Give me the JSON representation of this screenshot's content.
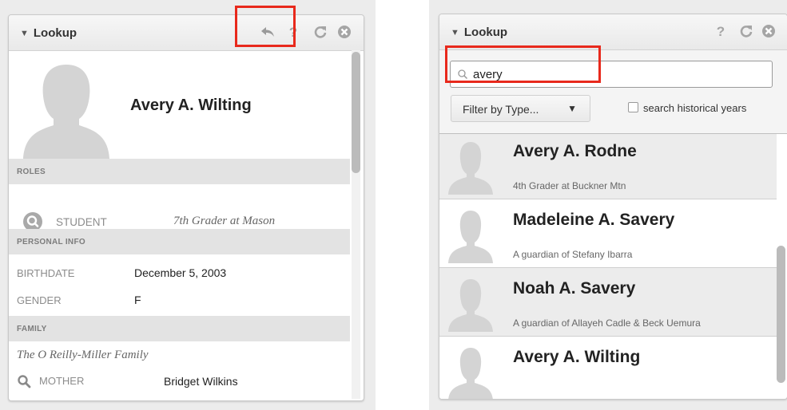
{
  "left_panel": {
    "header": {
      "title": "Lookup"
    },
    "person": {
      "name": "Avery A. Wilting"
    },
    "roles": {
      "heading": "ROLES",
      "items": [
        {
          "role": "STUDENT",
          "detail": "7th Grader at Mason"
        }
      ]
    },
    "personal_info": {
      "heading": "PERSONAL INFO",
      "fields": [
        {
          "label": "BIRTHDATE",
          "value": "December 5, 2003"
        },
        {
          "label": "GENDER",
          "value": "F"
        }
      ]
    },
    "family": {
      "heading": "FAMILY",
      "family_name": "The O Reilly-Miller Family",
      "members": [
        {
          "relation": "MOTHER",
          "name": "Bridget Wilkins"
        }
      ]
    }
  },
  "right_panel": {
    "header": {
      "title": "Lookup"
    },
    "search": {
      "value": "avery"
    },
    "filter": {
      "label": "Filter by Type..."
    },
    "historical_checkbox": {
      "label": "search historical years",
      "checked": false
    },
    "results": [
      {
        "name": "Avery A. Rodne",
        "subtitle": "4th Grader at Buckner Mtn"
      },
      {
        "name": "Madeleine A. Savery",
        "subtitle": "A guardian of Stefany Ibarra"
      },
      {
        "name": "Noah A. Savery",
        "subtitle": "A guardian of Allayeh Cadle & Beck Uemura"
      },
      {
        "name": "Avery A. Wilting",
        "subtitle": ""
      }
    ]
  },
  "colors": {
    "highlight_box": "#e8291c",
    "section_bg": "#e3e3e3",
    "avatar": "#d4d4d4"
  },
  "icons": [
    "collapse-triangle-icon",
    "back-arrow-icon",
    "help-icon",
    "refresh-icon",
    "close-icon",
    "search-icon",
    "dropdown-arrow-icon"
  ]
}
